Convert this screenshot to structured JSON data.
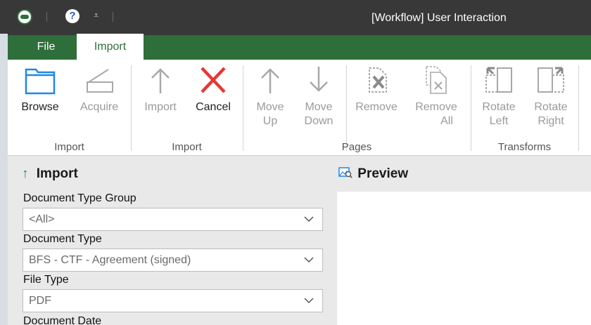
{
  "window": {
    "title": "[Workflow] User Interaction"
  },
  "tabs": {
    "file": "File",
    "import": "Import"
  },
  "ribbon": {
    "buttons": {
      "browse": "Browse",
      "acquire": "Acquire",
      "import": "Import",
      "cancel": "Cancel",
      "move_up_1": "Move",
      "move_up_2": "Up",
      "move_down_1": "Move",
      "move_down_2": "Down",
      "remove": "Remove",
      "remove_all_1": "Remove",
      "remove_all_2": "All",
      "rotate_left_1": "Rotate",
      "rotate_left_2": "Left",
      "rotate_right_1": "Rotate",
      "rotate_right_2": "Right"
    },
    "groups": {
      "import_1": "Import",
      "import_2": "Import",
      "pages": "Pages",
      "transforms": "Transforms"
    }
  },
  "import_panel": {
    "title": "Import",
    "doc_type_group_label": "Document Type Group",
    "doc_type_group_value": "<All>",
    "doc_type_label": "Document Type",
    "doc_type_value": "BFS - CTF - Agreement (signed)",
    "file_type_label": "File Type",
    "file_type_value": "PDF",
    "doc_date_label": "Document Date"
  },
  "preview_panel": {
    "title": "Preview"
  },
  "colors": {
    "ribbon_green": "#2d6e3a",
    "title_dark": "#383838",
    "cancel_red": "#e53935",
    "browse_blue": "#1e88e5"
  }
}
